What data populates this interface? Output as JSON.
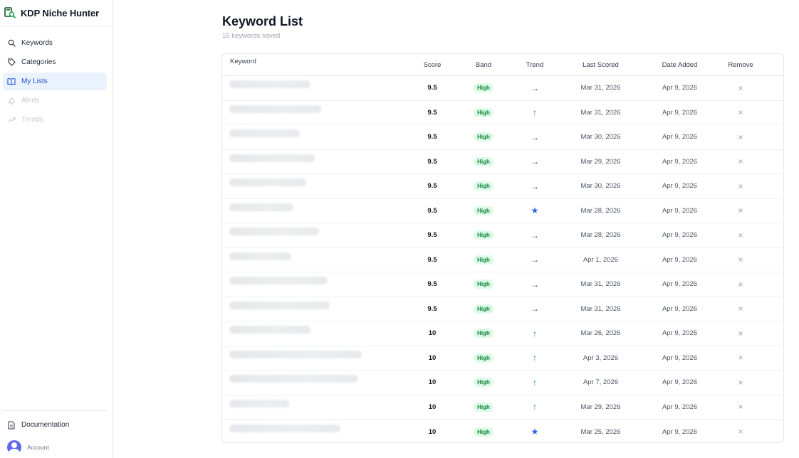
{
  "app": {
    "title": "KDP Niche Hunter"
  },
  "sidebar": {
    "items": [
      {
        "label": "Keywords",
        "icon": "search-icon",
        "state": "normal"
      },
      {
        "label": "Categories",
        "icon": "tag-icon",
        "state": "normal"
      },
      {
        "label": "My Lists",
        "icon": "book-icon",
        "state": "active"
      },
      {
        "label": "Alerts",
        "icon": "bell-icon",
        "state": "disabled"
      },
      {
        "label": "Trends",
        "icon": "trend-icon",
        "state": "disabled"
      }
    ],
    "documentation_label": "Documentation",
    "account_label": "Account"
  },
  "page": {
    "title": "Keyword List",
    "subtitle": "15 keywords saved"
  },
  "table": {
    "headers": {
      "keyword": "Keyword",
      "score": "Score",
      "band": "Band",
      "trend": "Trend",
      "last_scored": "Last Scored",
      "date_added": "Date Added",
      "remove": "Remove"
    },
    "rows": [
      {
        "blur": 0.38,
        "score": "9.5",
        "band": "High",
        "trend": "flat",
        "trend_glyph": "→",
        "last_scored": "Mar 31, 2026",
        "date_added": "Apr 9, 2026"
      },
      {
        "blur": 0.43,
        "score": "9.5",
        "band": "High",
        "trend": "up",
        "trend_glyph": "↑",
        "last_scored": "Mar 31, 2026",
        "date_added": "Apr 9, 2026"
      },
      {
        "blur": 0.33,
        "score": "9.5",
        "band": "High",
        "trend": "flat",
        "trend_glyph": "→",
        "last_scored": "Mar 30, 2026",
        "date_added": "Apr 9, 2026"
      },
      {
        "blur": 0.4,
        "score": "9.5",
        "band": "High",
        "trend": "flat",
        "trend_glyph": "→",
        "last_scored": "Mar 29, 2026",
        "date_added": "Apr 9, 2026"
      },
      {
        "blur": 0.36,
        "score": "9.5",
        "band": "High",
        "trend": "flat",
        "trend_glyph": "→",
        "last_scored": "Mar 30, 2026",
        "date_added": "Apr 9, 2026"
      },
      {
        "blur": 0.3,
        "score": "9.5",
        "band": "High",
        "trend": "star",
        "trend_glyph": "★",
        "last_scored": "Mar 28, 2026",
        "date_added": "Apr 9, 2026"
      },
      {
        "blur": 0.42,
        "score": "9.5",
        "band": "High",
        "trend": "flat",
        "trend_glyph": "→",
        "last_scored": "Mar 28, 2026",
        "date_added": "Apr 9, 2026"
      },
      {
        "blur": 0.29,
        "score": "9.5",
        "band": "High",
        "trend": "flat",
        "trend_glyph": "→",
        "last_scored": "Apr 1, 2026",
        "date_added": "Apr 9, 2026"
      },
      {
        "blur": 0.46,
        "score": "9.5",
        "band": "High",
        "trend": "flat",
        "trend_glyph": "→",
        "last_scored": "Mar 31, 2026",
        "date_added": "Apr 9, 2026"
      },
      {
        "blur": 0.47,
        "score": "9.5",
        "band": "High",
        "trend": "flat",
        "trend_glyph": "→",
        "last_scored": "Mar 31, 2026",
        "date_added": "Apr 9, 2026"
      },
      {
        "blur": 0.38,
        "score": "10",
        "band": "High",
        "trend": "up",
        "trend_glyph": "↑",
        "last_scored": "Mar 26, 2026",
        "date_added": "Apr 9, 2026"
      },
      {
        "blur": 0.62,
        "score": "10",
        "band": "High",
        "trend": "up",
        "trend_glyph": "↑",
        "last_scored": "Apr 3, 2026",
        "date_added": "Apr 9, 2026"
      },
      {
        "blur": 0.6,
        "score": "10",
        "band": "High",
        "trend": "up",
        "trend_glyph": "↑",
        "last_scored": "Apr 7, 2026",
        "date_added": "Apr 9, 2026"
      },
      {
        "blur": 0.28,
        "score": "10",
        "band": "High",
        "trend": "up",
        "trend_glyph": "↑",
        "last_scored": "Mar 29, 2026",
        "date_added": "Apr 9, 2026"
      },
      {
        "blur": 0.52,
        "score": "10",
        "band": "High",
        "trend": "star",
        "trend_glyph": "★",
        "last_scored": "Mar 25, 2026",
        "date_added": "Apr 9, 2026"
      }
    ],
    "remove_glyph": "×"
  },
  "colors": {
    "accent": "#1d4ed8",
    "active_bg": "#eaf2fd",
    "band_bg": "#dcfce7",
    "band_text": "#15803d",
    "trend_up": "#16a34a",
    "trend_star": "#2563eb",
    "avatar": "#6366f1"
  }
}
